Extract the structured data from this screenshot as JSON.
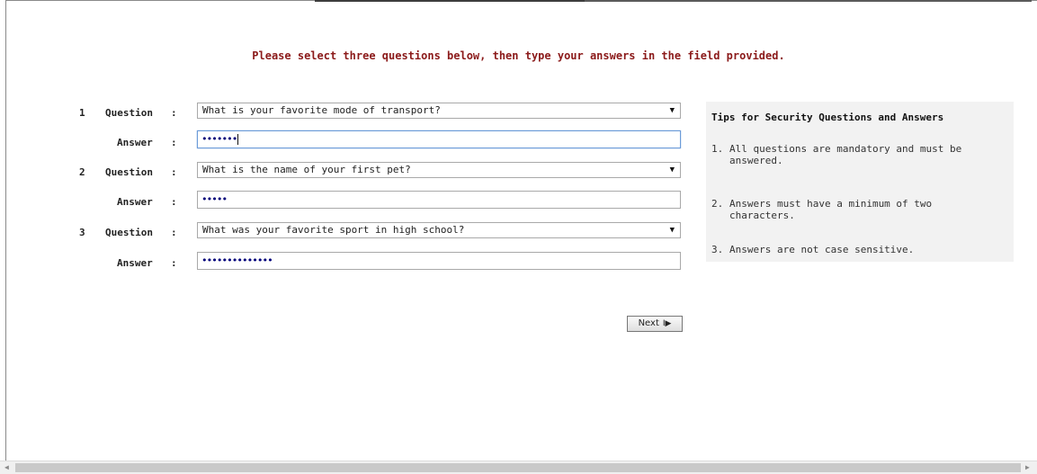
{
  "instruction": "Please select three questions below, then type your answers in the field provided.",
  "rows": [
    {
      "num": "1",
      "question_label": "Question",
      "answer_label": "Answer",
      "colon": ":",
      "question": "What is your favorite mode of transport?",
      "answer_mask": "•••••••"
    },
    {
      "num": "2",
      "question_label": "Question",
      "answer_label": "Answer",
      "colon": ":",
      "question": "What is the name of your first pet?",
      "answer_mask": "•••••"
    },
    {
      "num": "3",
      "question_label": "Question",
      "answer_label": "Answer",
      "colon": ":",
      "question": "What was your favorite sport in high school?",
      "answer_mask": "••••••••••••••"
    }
  ],
  "next_button": {
    "label": "Next",
    "icon": "play-next-icon"
  },
  "tips": {
    "title": "Tips for Security Questions and Answers",
    "items": [
      {
        "num": "1.",
        "text": "All questions are mandatory and must be answered."
      },
      {
        "num": "2.",
        "text": "Answers must have a minimum of two characters."
      },
      {
        "num": "3.",
        "text": "Answers are not case sensitive."
      }
    ]
  },
  "colors": {
    "instruction": "#8b1a1a",
    "password_dots": "#00007a",
    "tips_bg": "#f2f2f2"
  },
  "icons": {
    "dropdown": "chevron-down-icon",
    "scroll_left": "arrow-left-icon",
    "scroll_right": "arrow-right-icon"
  }
}
